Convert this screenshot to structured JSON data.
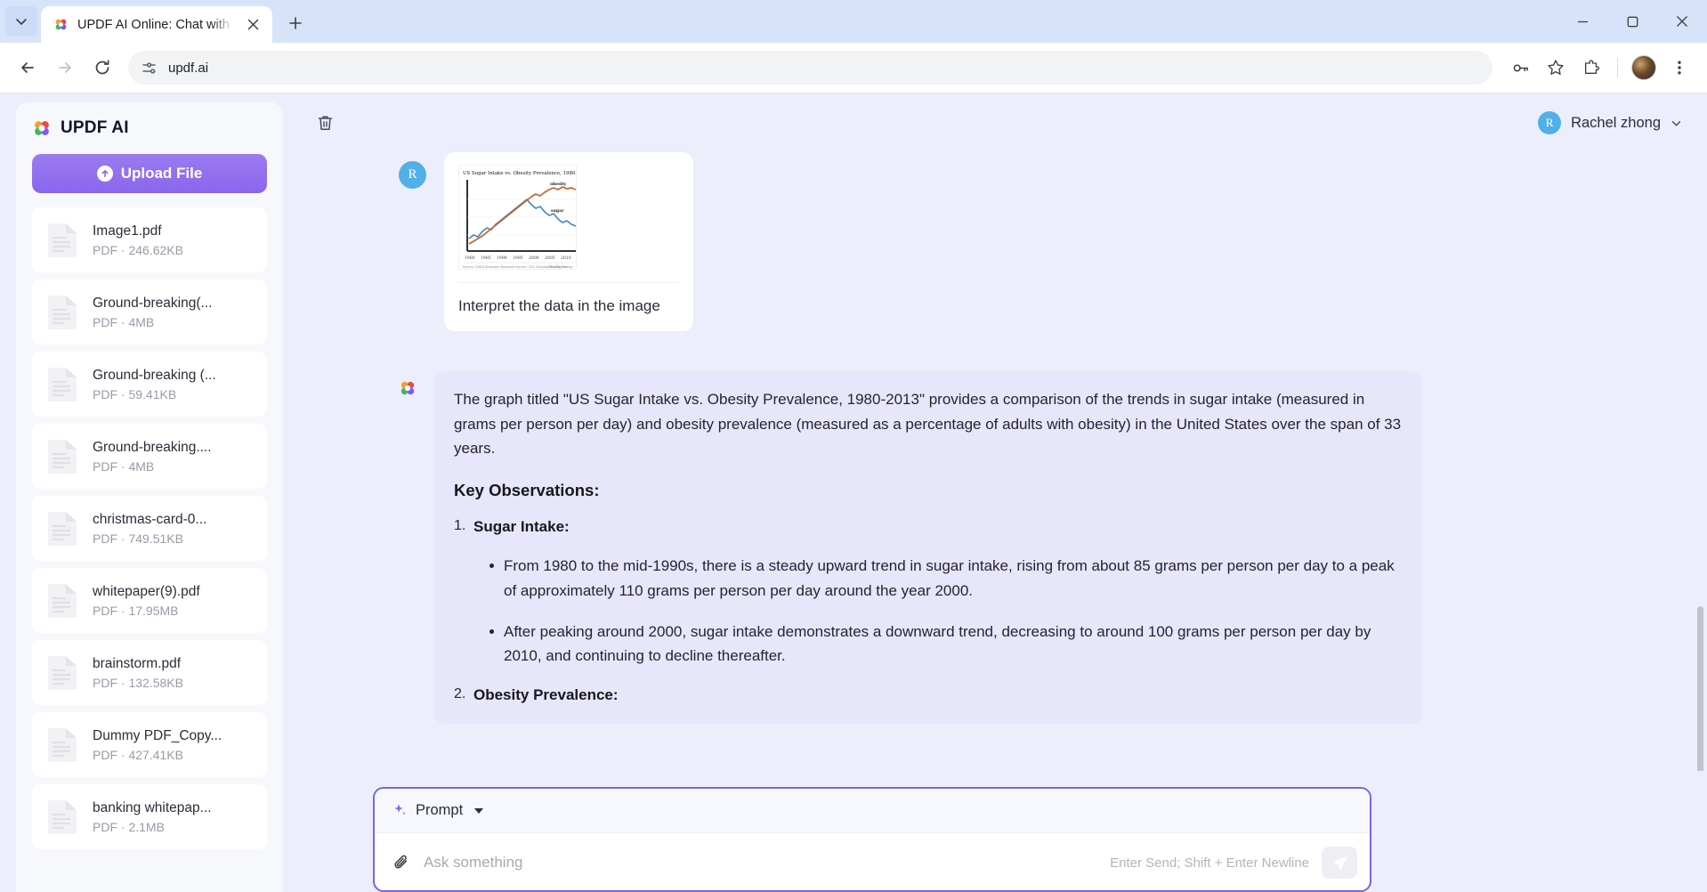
{
  "browser": {
    "tab": {
      "title": "UPDF AI Online: Chat with PDF",
      "favicon_icon": "updf-logo-icon",
      "close_icon": "close-icon"
    },
    "tab_list_icon": "chevron-down-icon",
    "new_tab_icon": "plus-icon",
    "window_controls": {
      "minimize_icon": "minimize-icon",
      "maximize_icon": "maximize-icon",
      "close_icon": "window-close-icon"
    },
    "nav": {
      "back_icon": "back-arrow-icon",
      "forward_icon": "forward-arrow-icon",
      "reload_icon": "reload-icon",
      "site_settings_icon": "site-settings-icon",
      "url": "updf.ai",
      "password_icon": "password-key-icon",
      "bookmark_icon": "star-icon",
      "extensions_icon": "extensions-puzzle-icon",
      "profile_icon": "profile-avatar-icon",
      "menu_icon": "three-dots-menu-icon"
    }
  },
  "sidebar": {
    "brand": {
      "name": "UPDF AI",
      "logo_icon": "updf-logo-icon"
    },
    "upload_button": {
      "label": "Upload File",
      "icon": "upload-arrow-icon"
    },
    "files": [
      {
        "name": "Image1.pdf",
        "meta": "PDF · 246.62KB"
      },
      {
        "name": "Ground-breaking(...",
        "meta": "PDF · 4MB"
      },
      {
        "name": "Ground-breaking (...",
        "meta": "PDF · 59.41KB"
      },
      {
        "name": "Ground-breaking....",
        "meta": "PDF · 4MB"
      },
      {
        "name": "christmas-card-0...",
        "meta": "PDF · 749.51KB"
      },
      {
        "name": "whitepaper(9).pdf",
        "meta": "PDF · 17.95MB"
      },
      {
        "name": "brainstorm.pdf",
        "meta": "PDF · 132.58KB"
      },
      {
        "name": "Dummy PDF_Copy...",
        "meta": "PDF · 427.41KB"
      },
      {
        "name": "banking whitepap...",
        "meta": "PDF · 2.1MB"
      }
    ]
  },
  "header": {
    "delete_icon": "trash-icon",
    "user": {
      "initial": "R",
      "name": "Rachel zhong",
      "chevron_icon": "chevron-down-icon"
    }
  },
  "conversation": {
    "user_message": {
      "avatar_initial": "R",
      "text": "Interpret the data in the image",
      "attachment_alt": "US Sugar Intake vs. Obesity Prevalence, 1980-2013 chart"
    },
    "ai_message": {
      "logo_icon": "updf-ai-logo-icon",
      "intro": "The graph titled \"US Sugar Intake vs. Obesity Prevalence, 1980-2013\" provides a comparison of the trends in sugar intake (measured in grams per person per day) and obesity prevalence (measured as a percentage of adults with obesity) in the United States over the span of 33 years.",
      "heading": "Key Observations:",
      "items": [
        {
          "num": "1.",
          "title": "Sugar Intake:",
          "bullets": [
            "From 1980 to the mid-1990s, there is a steady upward trend in sugar intake, rising from about 85 grams per person per day to a peak of approximately 110 grams per person per day around the year 2000.",
            "After peaking around 2000, sugar intake demonstrates a downward trend, decreasing to around 100 grams per person per day by 2010, and continuing to decline thereafter."
          ]
        },
        {
          "num": "2.",
          "title": "Obesity Prevalence:",
          "bullets": []
        }
      ]
    }
  },
  "composer": {
    "prompt_label": "Prompt",
    "prompt_icon": "sparkle-icon",
    "chevron_icon": "caret-down-icon",
    "attach_icon": "paperclip-icon",
    "input_value": "",
    "input_placeholder": "Ask something",
    "hint": "Enter Send; Shift + Enter Newline",
    "send_icon": "send-paper-plane-icon"
  },
  "colors": {
    "accent_purple": "#8a66ee",
    "ai_bubble": "#e7e6fa",
    "composer_border": "#7a63e8",
    "avatar_blue": "#52b0e8",
    "chrome_tabstrip": "#d7e3f8"
  },
  "chart_data": {
    "type": "line",
    "title": "US Sugar Intake vs. Obesity Prevalence, 1980-2013",
    "xlabel": "",
    "ylabel": "",
    "x": [
      1980,
      1982,
      1984,
      1986,
      1988,
      1990,
      1992,
      1994,
      1996,
      1998,
      2000,
      2002,
      2004,
      2006,
      2008,
      2010,
      2012,
      2013
    ],
    "xticks": [
      "1980",
      "1985",
      "1990",
      "1995",
      "2000",
      "2005",
      "2010"
    ],
    "series": [
      {
        "name": "sugar",
        "color": "#4b85bd",
        "values": [
          85,
          88,
          92,
          91,
          96,
          98,
          100,
          103,
          106,
          108,
          110,
          106,
          105,
          103,
          101,
          100,
          97,
          96
        ]
      },
      {
        "name": "obesity",
        "color": "#c8622a",
        "values": [
          15,
          17,
          19,
          21,
          24,
          27,
          30,
          33,
          36,
          39,
          42,
          45,
          48,
          50,
          52,
          53,
          54,
          54
        ]
      }
    ],
    "legend_position": "right",
    "grid": false,
    "footnote_left": "Source: USDA Economic Research Service, CDC National Health Surveys",
    "footnote_right": "Chart by Vox"
  }
}
